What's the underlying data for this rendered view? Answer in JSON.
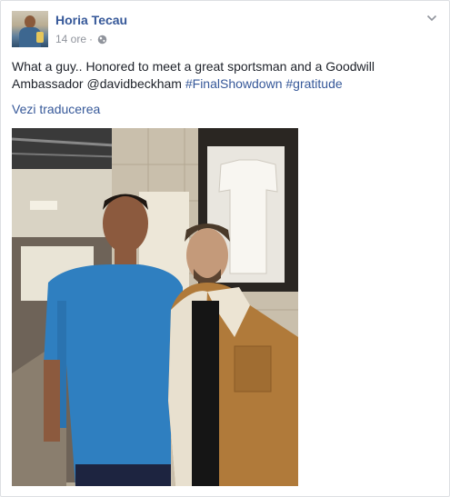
{
  "post": {
    "author": "Horia Tecau",
    "time": "14 ore",
    "separator": "·",
    "text_main": "What a guy.. Honored to meet a great sportsman and a Goodwill Ambassador @davidbeckham ",
    "hashtags": [
      "#FinalShowdown",
      "#gratitude"
    ],
    "translate_link": "Vezi traducerea",
    "privacy_icon": "globe-icon",
    "menu_icon": "chevron-down-icon"
  },
  "colors": {
    "link": "#365899",
    "meta": "#90949c",
    "text": "#1d2129"
  }
}
